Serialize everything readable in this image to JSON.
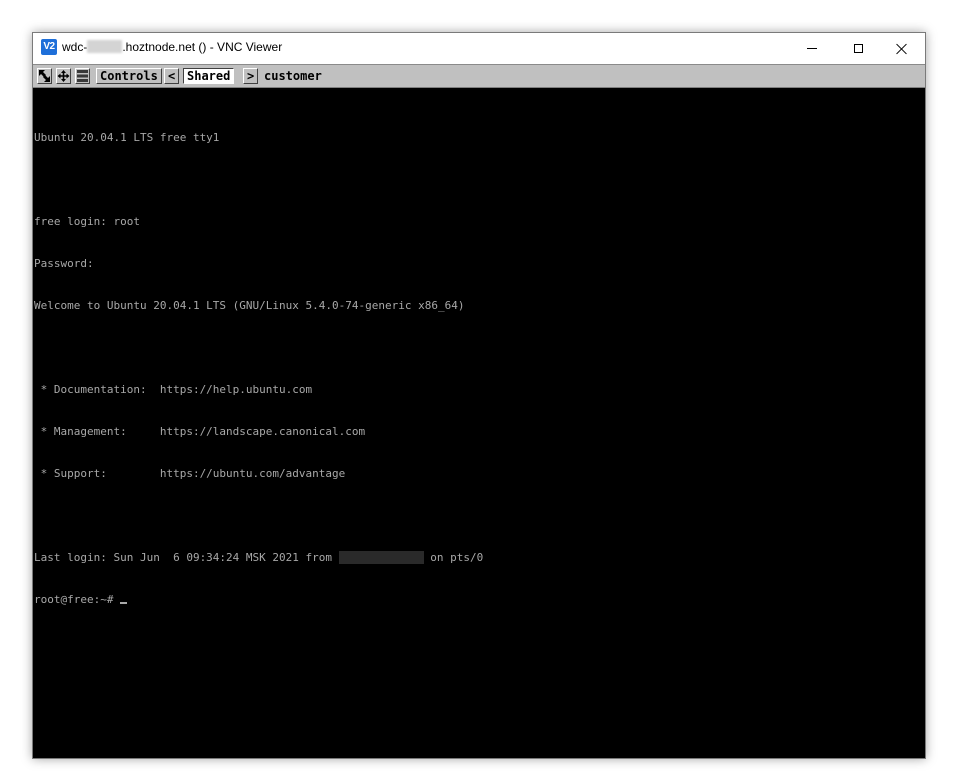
{
  "window": {
    "title_prefix": "wdc-",
    "title_suffix": ".hoztnode.net () - VNC Viewer",
    "app_icon_text": "V2",
    "icons": {
      "app": "vnc-viewer-icon",
      "minimize": "minimize-icon",
      "maximize": "maximize-icon",
      "close": "close-icon"
    }
  },
  "toolbar": {
    "icons": [
      "scale-arrow-icon",
      "move-arrows-icon",
      "ctrl-alt-del-icon"
    ],
    "controls_label": "Controls",
    "prev_label": "<",
    "shared_label": "Shared",
    "next_label": ">",
    "user_label": "customer"
  },
  "terminal": {
    "lines": [
      "Ubuntu 20.04.1 LTS free tty1",
      "",
      "free login: root",
      "Password:",
      "Welcome to Ubuntu 20.04.1 LTS (GNU/Linux 5.4.0-74-generic x86_64)",
      "",
      " * Documentation:  https://help.ubuntu.com",
      " * Management:     https://landscape.canonical.com",
      " * Support:        https://ubuntu.com/advantage",
      ""
    ],
    "last_login_prefix": "Last login: Sun Jun  6 09:34:24 MSK 2021 from ",
    "last_login_suffix": " on pts/0",
    "prompt": "root@free:~# "
  },
  "colors": {
    "terminal_bg": "#000000",
    "terminal_fg": "#a8a8a8",
    "toolbar_bg": "#c0c0c0",
    "app_icon_bg": "#1e6fd9"
  }
}
